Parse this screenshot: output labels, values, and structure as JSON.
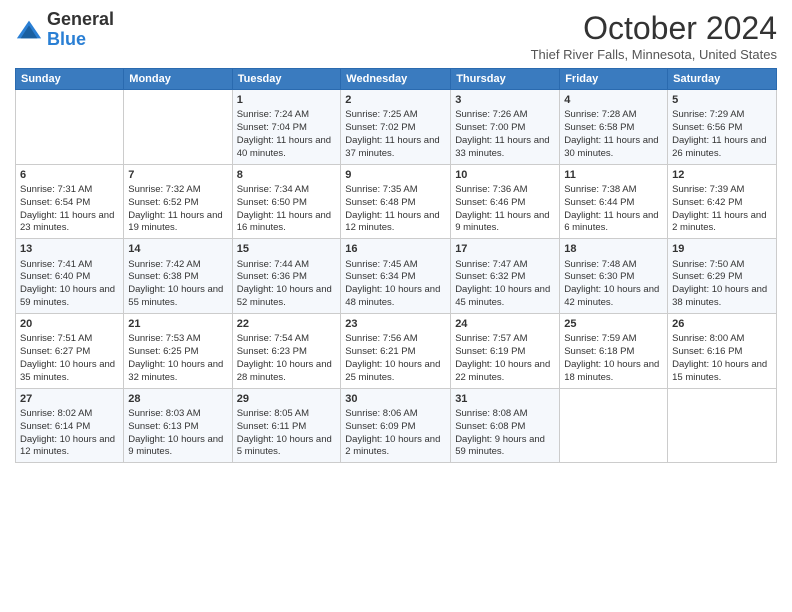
{
  "header": {
    "logo": {
      "general": "General",
      "blue": "Blue"
    },
    "title": "October 2024",
    "subtitle": "Thief River Falls, Minnesota, United States"
  },
  "days_of_week": [
    "Sunday",
    "Monday",
    "Tuesday",
    "Wednesday",
    "Thursday",
    "Friday",
    "Saturday"
  ],
  "weeks": [
    [
      {
        "day": "",
        "content": ""
      },
      {
        "day": "",
        "content": ""
      },
      {
        "day": "1",
        "content": "Sunrise: 7:24 AM\nSunset: 7:04 PM\nDaylight: 11 hours and 40 minutes."
      },
      {
        "day": "2",
        "content": "Sunrise: 7:25 AM\nSunset: 7:02 PM\nDaylight: 11 hours and 37 minutes."
      },
      {
        "day": "3",
        "content": "Sunrise: 7:26 AM\nSunset: 7:00 PM\nDaylight: 11 hours and 33 minutes."
      },
      {
        "day": "4",
        "content": "Sunrise: 7:28 AM\nSunset: 6:58 PM\nDaylight: 11 hours and 30 minutes."
      },
      {
        "day": "5",
        "content": "Sunrise: 7:29 AM\nSunset: 6:56 PM\nDaylight: 11 hours and 26 minutes."
      }
    ],
    [
      {
        "day": "6",
        "content": "Sunrise: 7:31 AM\nSunset: 6:54 PM\nDaylight: 11 hours and 23 minutes."
      },
      {
        "day": "7",
        "content": "Sunrise: 7:32 AM\nSunset: 6:52 PM\nDaylight: 11 hours and 19 minutes."
      },
      {
        "day": "8",
        "content": "Sunrise: 7:34 AM\nSunset: 6:50 PM\nDaylight: 11 hours and 16 minutes."
      },
      {
        "day": "9",
        "content": "Sunrise: 7:35 AM\nSunset: 6:48 PM\nDaylight: 11 hours and 12 minutes."
      },
      {
        "day": "10",
        "content": "Sunrise: 7:36 AM\nSunset: 6:46 PM\nDaylight: 11 hours and 9 minutes."
      },
      {
        "day": "11",
        "content": "Sunrise: 7:38 AM\nSunset: 6:44 PM\nDaylight: 11 hours and 6 minutes."
      },
      {
        "day": "12",
        "content": "Sunrise: 7:39 AM\nSunset: 6:42 PM\nDaylight: 11 hours and 2 minutes."
      }
    ],
    [
      {
        "day": "13",
        "content": "Sunrise: 7:41 AM\nSunset: 6:40 PM\nDaylight: 10 hours and 59 minutes."
      },
      {
        "day": "14",
        "content": "Sunrise: 7:42 AM\nSunset: 6:38 PM\nDaylight: 10 hours and 55 minutes."
      },
      {
        "day": "15",
        "content": "Sunrise: 7:44 AM\nSunset: 6:36 PM\nDaylight: 10 hours and 52 minutes."
      },
      {
        "day": "16",
        "content": "Sunrise: 7:45 AM\nSunset: 6:34 PM\nDaylight: 10 hours and 48 minutes."
      },
      {
        "day": "17",
        "content": "Sunrise: 7:47 AM\nSunset: 6:32 PM\nDaylight: 10 hours and 45 minutes."
      },
      {
        "day": "18",
        "content": "Sunrise: 7:48 AM\nSunset: 6:30 PM\nDaylight: 10 hours and 42 minutes."
      },
      {
        "day": "19",
        "content": "Sunrise: 7:50 AM\nSunset: 6:29 PM\nDaylight: 10 hours and 38 minutes."
      }
    ],
    [
      {
        "day": "20",
        "content": "Sunrise: 7:51 AM\nSunset: 6:27 PM\nDaylight: 10 hours and 35 minutes."
      },
      {
        "day": "21",
        "content": "Sunrise: 7:53 AM\nSunset: 6:25 PM\nDaylight: 10 hours and 32 minutes."
      },
      {
        "day": "22",
        "content": "Sunrise: 7:54 AM\nSunset: 6:23 PM\nDaylight: 10 hours and 28 minutes."
      },
      {
        "day": "23",
        "content": "Sunrise: 7:56 AM\nSunset: 6:21 PM\nDaylight: 10 hours and 25 minutes."
      },
      {
        "day": "24",
        "content": "Sunrise: 7:57 AM\nSunset: 6:19 PM\nDaylight: 10 hours and 22 minutes."
      },
      {
        "day": "25",
        "content": "Sunrise: 7:59 AM\nSunset: 6:18 PM\nDaylight: 10 hours and 18 minutes."
      },
      {
        "day": "26",
        "content": "Sunrise: 8:00 AM\nSunset: 6:16 PM\nDaylight: 10 hours and 15 minutes."
      }
    ],
    [
      {
        "day": "27",
        "content": "Sunrise: 8:02 AM\nSunset: 6:14 PM\nDaylight: 10 hours and 12 minutes."
      },
      {
        "day": "28",
        "content": "Sunrise: 8:03 AM\nSunset: 6:13 PM\nDaylight: 10 hours and 9 minutes."
      },
      {
        "day": "29",
        "content": "Sunrise: 8:05 AM\nSunset: 6:11 PM\nDaylight: 10 hours and 5 minutes."
      },
      {
        "day": "30",
        "content": "Sunrise: 8:06 AM\nSunset: 6:09 PM\nDaylight: 10 hours and 2 minutes."
      },
      {
        "day": "31",
        "content": "Sunrise: 8:08 AM\nSunset: 6:08 PM\nDaylight: 9 hours and 59 minutes."
      },
      {
        "day": "",
        "content": ""
      },
      {
        "day": "",
        "content": ""
      }
    ]
  ]
}
